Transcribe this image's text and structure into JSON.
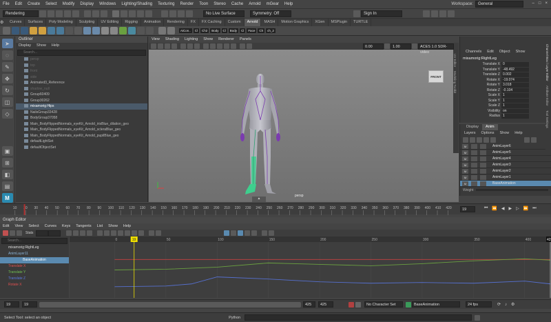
{
  "menubar": {
    "items": [
      "File",
      "Edit",
      "Create",
      "Select",
      "Modify",
      "Display",
      "Windows",
      "Lighting/Shading",
      "Texturing",
      "Render",
      "Toon",
      "Stereo",
      "Cache",
      "Arnold",
      "mGear",
      "Help"
    ],
    "workspace_label": "Workspace:",
    "workspace_value": "General"
  },
  "statusline": {
    "menuset": "Rendering",
    "live_surface": "No Live Surface",
    "symmetry": "Symmetry: Off",
    "sign_in": "Sign In"
  },
  "shelf": {
    "tabs": [
      "Curves",
      "Surfaces",
      "Poly Modeling",
      "Sculpting",
      "UV Editing",
      "Rigging",
      "Animation",
      "Rendering",
      "FX",
      "FX Caching",
      "Custom",
      "Arnold",
      "MASH",
      "Motion Graphics",
      "XGen",
      "MSPlugin",
      "TURTLE"
    ],
    "active_tab": "Arnold",
    "text_buttons": [
      "AiCon..",
      "Cl",
      "Ch2",
      "Body",
      "Cl",
      "Body",
      "Cl",
      "Face",
      "Ch",
      "ch_2"
    ]
  },
  "outliner": {
    "title": "Outliner",
    "menu": [
      "Display",
      "Show",
      "Help"
    ],
    "search_placeholder": "Search...",
    "items": [
      {
        "label": "persp",
        "dim": true,
        "selected": false
      },
      {
        "label": "top",
        "dim": true,
        "selected": false
      },
      {
        "label": "front",
        "dim": true,
        "selected": false
      },
      {
        "label": "side",
        "dim": true,
        "selected": false
      },
      {
        "label": "Animated3_Reference",
        "dim": false,
        "selected": false
      },
      {
        "label": "shadow_null",
        "dim": true,
        "selected": false
      },
      {
        "label": "Group60409",
        "dim": false,
        "selected": false
      },
      {
        "label": "Group30262",
        "dim": false,
        "selected": false
      },
      {
        "label": "mixamorig:Hips",
        "dim": false,
        "selected": true
      },
      {
        "label": "NailsGroup33428",
        "dim": false,
        "selected": false
      },
      {
        "label": "BodyGroup37058",
        "dim": false,
        "selected": false
      },
      {
        "label": "Main_BodyFlippedNormals_eyeKit_Arnold_irisBlue_dilation_geo",
        "dim": false,
        "selected": false
      },
      {
        "label": "Main_BodyFlippedNormals_eyeKit_Arnold_scleraBlue_geo",
        "dim": false,
        "selected": false
      },
      {
        "label": "Main_BodyFlippedNormals_eyeKit_Arnold_pupilBlue_geo",
        "dim": false,
        "selected": false
      },
      {
        "label": "defaultLightSet",
        "dim": false,
        "selected": false
      },
      {
        "label": "defaultObjectSet",
        "dim": false,
        "selected": false
      }
    ]
  },
  "viewport": {
    "menu": [
      "View",
      "Shading",
      "Lighting",
      "Show",
      "Renderer",
      "Panels"
    ],
    "field_a": "0.00",
    "field_b": "1.00",
    "colorspace": "ACES 1.0 SDR-video",
    "front_label": "FRONT",
    "camera_label": "persp"
  },
  "side_tabs": [
    "UV Editor",
    "Modeling Toolkit"
  ],
  "side_tabs_right": [
    "Channel Box / Layer Editor",
    "Attribute Editor",
    "Tool Settings"
  ],
  "channelbox": {
    "menu": [
      "Channels",
      "Edit",
      "Object",
      "Show"
    ],
    "object": "mixamorig:RightLeg",
    "attrs": [
      {
        "name": "Translate X",
        "value": "0"
      },
      {
        "name": "Translate Y",
        "value": "-48.492"
      },
      {
        "name": "Translate Z",
        "value": "0.002"
      },
      {
        "name": "Rotate X",
        "value": "-19.074"
      },
      {
        "name": "Rotate Y",
        "value": "3.018"
      },
      {
        "name": "Rotate Z",
        "value": "-0.104"
      },
      {
        "name": "Scale X",
        "value": "1"
      },
      {
        "name": "Scale Y",
        "value": "1"
      },
      {
        "name": "Scale Z",
        "value": "1"
      },
      {
        "name": "Visibility",
        "value": "on"
      },
      {
        "name": "Radius",
        "value": "1"
      }
    ]
  },
  "layers": {
    "tabs": [
      "Display",
      "Anim"
    ],
    "active_tab": "Anim",
    "menu": [
      "Layers",
      "Options",
      "Show",
      "Help"
    ],
    "toggle_label": "M",
    "items": [
      "AnimLayer6",
      "AnimLayer5",
      "AnimLayer4",
      "AnimLayer3",
      "AnimLayer2",
      "AnimLayer1",
      "BaseAnimation"
    ],
    "weight_label": "Weight"
  },
  "timeslider": {
    "ticks": [
      "10",
      "20",
      "30",
      "40",
      "50",
      "60",
      "70",
      "80",
      "90",
      "100",
      "110",
      "120",
      "130",
      "140",
      "150",
      "160",
      "170",
      "180",
      "190",
      "200",
      "210",
      "220",
      "230",
      "240",
      "250",
      "260",
      "270",
      "280",
      "290",
      "300",
      "310",
      "320",
      "330",
      "340",
      "350",
      "360",
      "370",
      "380",
      "390",
      "400",
      "410",
      "420"
    ],
    "current_frame": "19"
  },
  "graph_editor": {
    "title": "Graph Editor",
    "menu": [
      "Edit",
      "View",
      "Select",
      "Curves",
      "Keys",
      "Tangents",
      "List",
      "Show",
      "Help"
    ],
    "stats_label": "Stats",
    "search_placeholder": "Search...",
    "outline_items": [
      {
        "label": "mixamorig:RightLeg",
        "color": "#dddddd",
        "highlight": false
      },
      {
        "label": "AnimLayer11",
        "color": "#8ab4d8",
        "highlight": false
      },
      {
        "label": "BaseAnimation",
        "color": "#ffffff",
        "highlight": true
      },
      {
        "label": "Translate X",
        "color": "#e05050",
        "highlight": false
      },
      {
        "label": "Translate Y",
        "color": "#70c050",
        "highlight": false
      },
      {
        "label": "Translate Z",
        "color": "#5a7ae0",
        "highlight": false
      },
      {
        "label": "Rotate X",
        "color": "#e05050",
        "highlight": false
      }
    ],
    "ruler": [
      "0",
      "50",
      "100",
      "150",
      "200",
      "250",
      "300",
      "350",
      "400"
    ],
    "current_marker": "19",
    "end_marker": "425",
    "curves": [
      {
        "name": "Translate X",
        "color": "#c84040",
        "points": [
          [
            0,
            65
          ],
          [
            100,
            65
          ],
          [
            200,
            65
          ],
          [
            300,
            65
          ],
          [
            425,
            65
          ]
        ]
      },
      {
        "name": "Translate Y",
        "color": "#6aa040",
        "points": [
          [
            0,
            80
          ],
          [
            50,
            79
          ],
          [
            100,
            76
          ],
          [
            150,
            70
          ],
          [
            200,
            72
          ],
          [
            250,
            74
          ],
          [
            300,
            71
          ],
          [
            350,
            67
          ],
          [
            400,
            64
          ],
          [
            425,
            66
          ]
        ]
      },
      {
        "name": "Translate Z",
        "color": "#5670d0",
        "points": [
          [
            0,
            104
          ],
          [
            50,
            103
          ],
          [
            75,
            100
          ],
          [
            100,
            90
          ],
          [
            150,
            93
          ],
          [
            200,
            97
          ],
          [
            250,
            99
          ],
          [
            300,
            98
          ],
          [
            350,
            99
          ],
          [
            400,
            96
          ],
          [
            425,
            100
          ]
        ]
      }
    ],
    "value_range": [
      40,
      120
    ]
  },
  "rangeslider": {
    "start": "19",
    "inner_start": "19",
    "inner_end": "425",
    "end": "425",
    "character_set": "No Character Set",
    "anim_layer": "BaseAnimation",
    "fps": "24 fps"
  },
  "cmdline": {
    "help_text": "Select Tool: select an object",
    "language": "Python"
  },
  "colors": {
    "accent": "#5a8ab0",
    "selection": "#4a5a6a",
    "playhead": "#f0e000"
  }
}
